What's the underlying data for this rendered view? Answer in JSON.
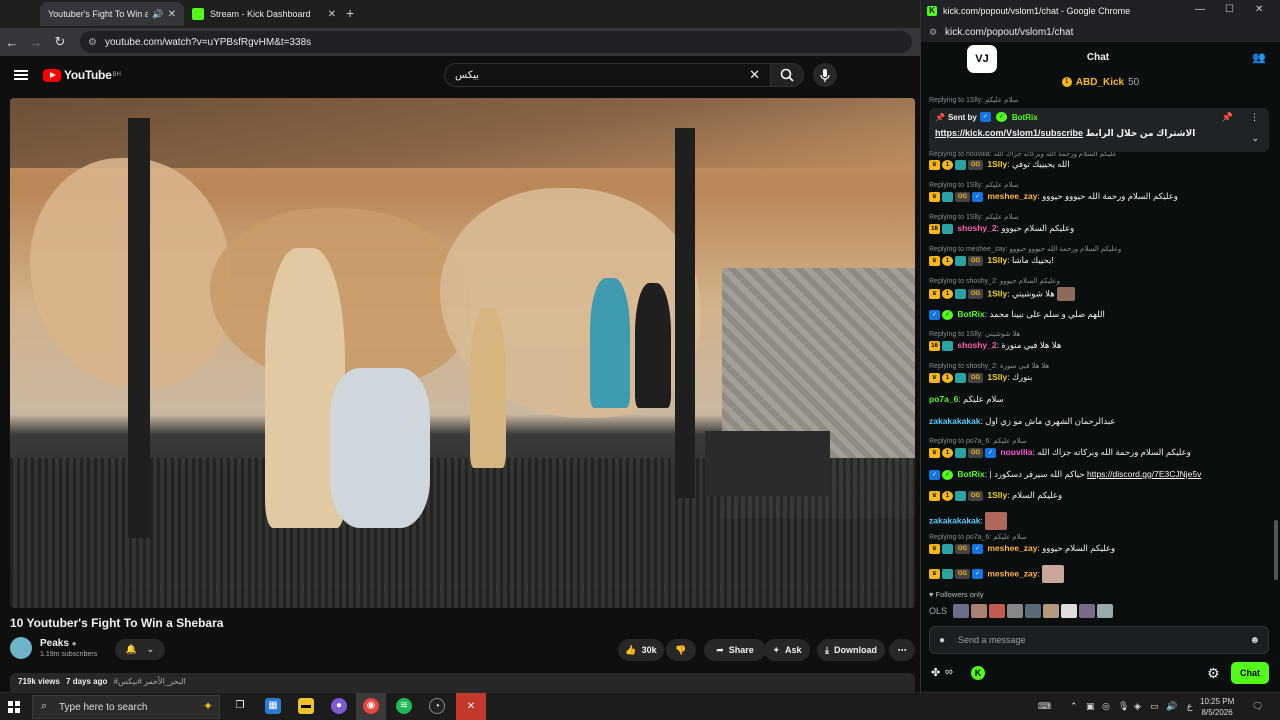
{
  "yt_window": {
    "tabs": [
      {
        "label": "Youtuber's Fight To Win a Shebara",
        "active": true
      },
      {
        "label": "Stream - Kick Dashboard",
        "active": false
      }
    ],
    "url": "youtube.com/watch?v=uYPBsfRgvHM&t=338s",
    "brand": "YouTube",
    "region": "BH",
    "search_value": "بيكس",
    "video": {
      "title": "10 Youtuber's Fight To Win a Shebara",
      "channel": "Peaks",
      "subscribers": "1.19m subscribers",
      "likes": "30k",
      "share_label": "Share",
      "ask_label": "Ask",
      "download_label": "Download",
      "views": "719k views",
      "age": "7 days ago",
      "tags": "#البحر_الأحمر #بيكس"
    }
  },
  "kick_window": {
    "title": "kick.com/popout/vslom1/chat - Google Chrome",
    "url": "kick.com/popout/vslom1/chat",
    "header": "Chat",
    "logo_text": "VJ",
    "top_gifter": {
      "name": "ABD_Kick",
      "count": "50"
    },
    "pinned": {
      "sent_by_label": "Sent by",
      "sender": "BotRix",
      "link": "https://kick.com/Vslom1/subscribe",
      "text": "الاشتراك من خلال الرابط"
    },
    "replies": [
      "Replying to 1Slly: سلام عليكم",
      "Replying to nouvilia: عليكم السلام ورحمة الله وبركاته جزاك الله",
      "Replying to 1Slly: سلام عليكم",
      "Replying to 1Slly: سلام عليكم",
      "Replying to meshee_zay: وعليكم السلام ورحمة الله حيووو حيووو",
      "Replying to shoshy_2: وعليكم السلام حيووو",
      "Replying to 1Slly: هلا شوشيتي",
      "Replying to shoshy_2: هلا هلا فيي منورة",
      "Replying to po7a_6: سلام عليكم",
      "Replying to po7a_6: سلام عليكم"
    ],
    "messages": [
      {
        "user": "1Slly",
        "text": "الله يحيييك توفي"
      },
      {
        "user": "meshee_zay",
        "text": "وعليكم السلام ورحمة الله حيووو حيووو"
      },
      {
        "user": "shoshy_2",
        "text": "وعليكم السلام حيووو"
      },
      {
        "user": "1Slly",
        "text": "يحييك ماشا!"
      },
      {
        "user": "1Slly",
        "text": "هلا شوشيتي"
      },
      {
        "user": "BotRix",
        "text": "اللهم صلي و سلم على نبينا محمد"
      },
      {
        "user": "shoshy_2",
        "text": "هلا هلا فيي منورة"
      },
      {
        "user": "1Slly",
        "text": "بنورك"
      },
      {
        "user": "po7a_6",
        "text": "سلام عليكم"
      },
      {
        "user": "zakakakakak",
        "text": "عبدالرحمان الشهري ماش مو زي اول"
      },
      {
        "user": "nouvilia",
        "text": "وعليكم السلام ورحمة الله وبركاته جزاك الله"
      },
      {
        "user": "BotRix",
        "text": "| حياكم الله سيرفر دسكورد",
        "link": "https://discord.gg/7E3CJNje5v"
      },
      {
        "user": "1Slly",
        "text": "وعليكم السلام"
      },
      {
        "user": "zakakakakak",
        "text": ""
      },
      {
        "user": "meshee_zay",
        "text": "وعليكم السلام حيووو"
      },
      {
        "user": "meshee_zay",
        "text": ""
      }
    ],
    "followers_only": "Followers only",
    "viewers_label": "OLS",
    "message_placeholder": "Send a message",
    "chat_button": "Chat"
  },
  "taskbar": {
    "search_placeholder": "Type here to search",
    "time": "10:25 PM",
    "date": "8/5/2026",
    "lang": "ع"
  },
  "colors": {
    "kick_green": "#53fc18",
    "gold": "#f5b816",
    "user_yellow": "#f5d20a",
    "user_orange": "#ffb53b",
    "user_pink": "#ff5fb3",
    "user_green": "#53fc18",
    "user_blue": "#5ac8fa",
    "user_magenta": "#ff4fd8"
  }
}
